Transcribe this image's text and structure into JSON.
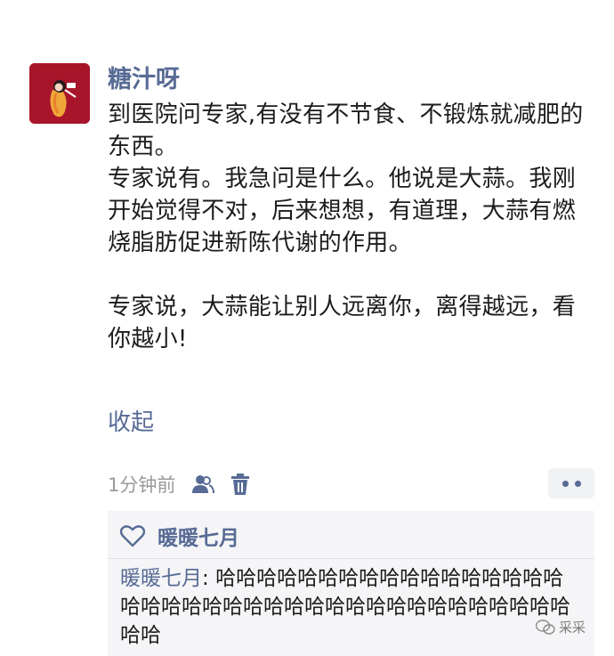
{
  "post": {
    "author": "糖汁呀",
    "lines": [
      "到医院问专家,有没有不节食、不锻炼就减肥的东西。",
      "专家说有。我急问是什么。他说是大蒜。我刚开始觉得不对，后来想想，有道理，大蒜有燃烧脂肪促进新陈代谢的作用。",
      "专家说，大蒜能让别人远离你，离得越远，看你越小!"
    ],
    "collapse_label": "收起",
    "timestamp": "1分钟前"
  },
  "icons": {
    "visibility": "people-icon",
    "delete": "trash-icon",
    "more": "more-dots-icon",
    "like": "heart-outline-icon"
  },
  "interactions": {
    "likes": [
      "暖暖七月"
    ],
    "comments": [
      {
        "author": "暖暖七月",
        "separator": ": ",
        "text": "哈哈哈哈哈哈哈哈哈哈哈哈哈哈哈哈哈哈哈哈哈哈哈哈哈哈哈哈哈哈哈哈哈哈哈哈哈哈哈哈哈"
      }
    ]
  },
  "watermark": {
    "text": "采采"
  },
  "colors": {
    "link": "#576b95",
    "panel": "#f5f5f7",
    "avatar": "#a8152a"
  }
}
